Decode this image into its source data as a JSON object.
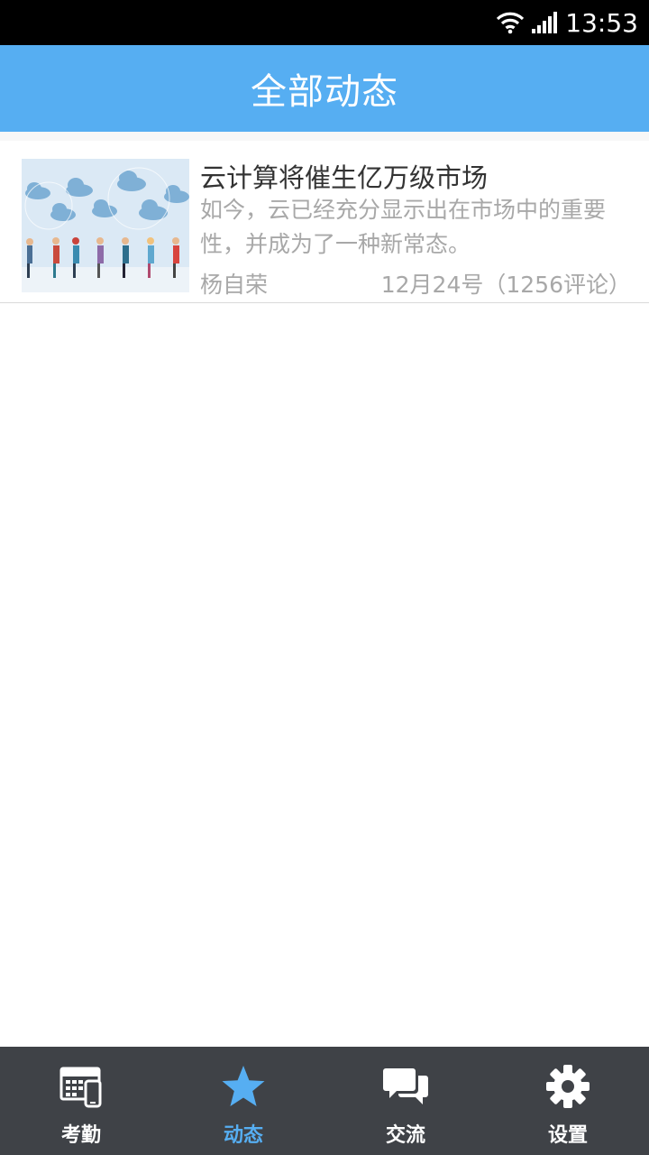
{
  "status_bar": {
    "time": "13:53"
  },
  "header": {
    "title": "全部动态"
  },
  "feed": [
    {
      "title": "云计算将催生亿万级市场",
      "summary": "如今，云已经充分显示出在市场中的重要性，并成为了一种新常态。",
      "author": "杨自荣",
      "date": "12月24号",
      "comments": "（1256评论）"
    }
  ],
  "tabs": [
    {
      "label": "考勤",
      "icon": "attendance-icon",
      "active": false
    },
    {
      "label": "动态",
      "icon": "star-icon",
      "active": true
    },
    {
      "label": "交流",
      "icon": "chat-icon",
      "active": false
    },
    {
      "label": "设置",
      "icon": "gear-icon",
      "active": false
    }
  ],
  "colors": {
    "accent": "#56aef2",
    "tab_bar": "#3f4247",
    "status_bar": "#000000"
  }
}
